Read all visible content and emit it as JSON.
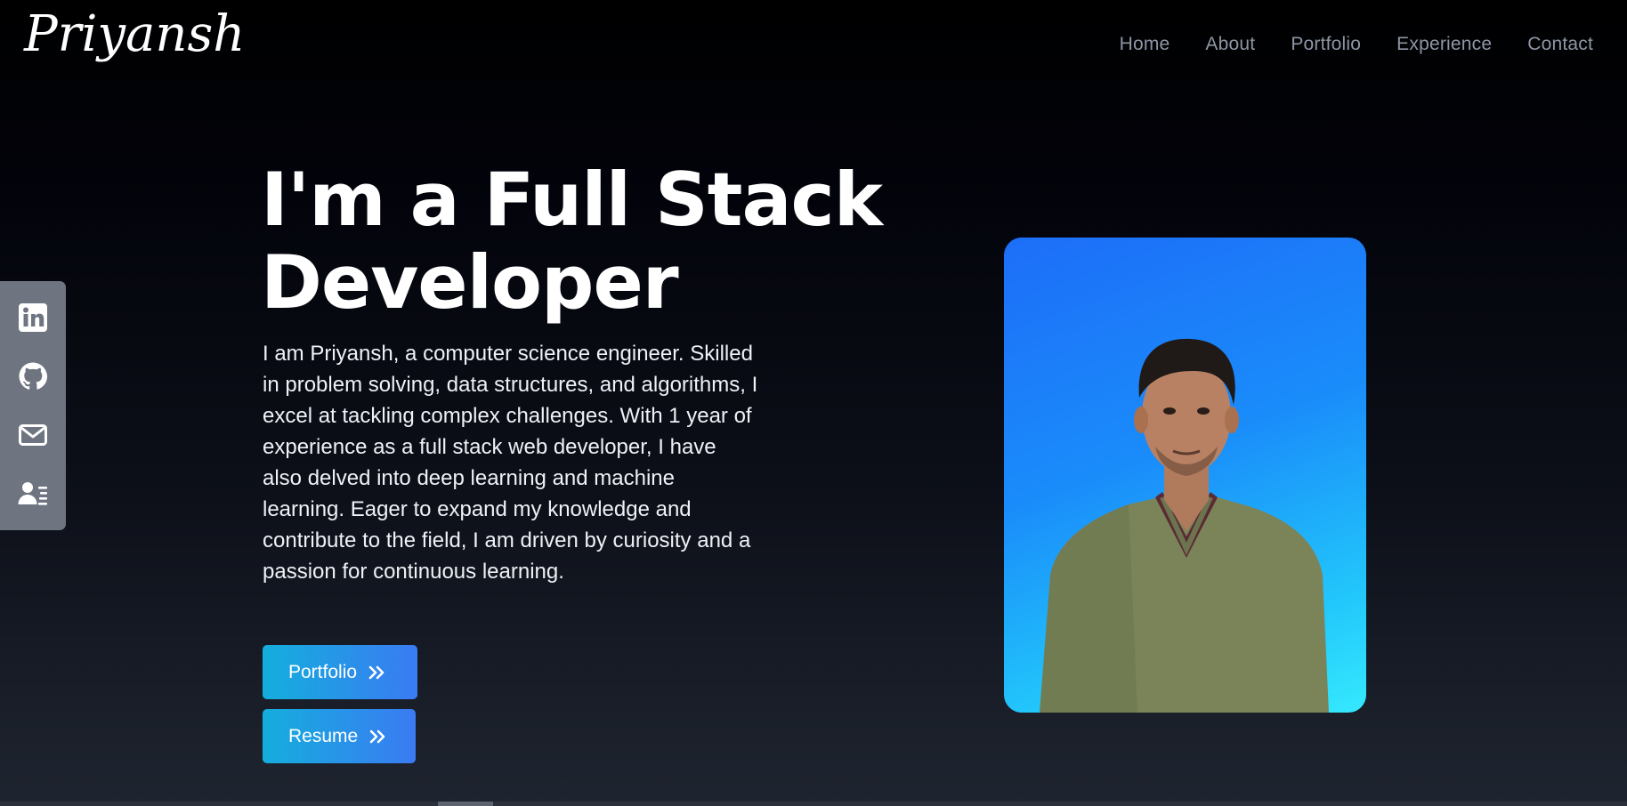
{
  "brand": {
    "logo_text": "Priyansh"
  },
  "nav": {
    "items": [
      {
        "label": "Home"
      },
      {
        "label": "About"
      },
      {
        "label": "Portfolio"
      },
      {
        "label": "Experience"
      },
      {
        "label": "Contact"
      }
    ]
  },
  "social": {
    "icons": [
      "linkedin-icon",
      "github-icon",
      "mail-icon",
      "contact-card-icon"
    ],
    "background": "#6e7480"
  },
  "hero": {
    "headline_line1": "I'm a Full Stack",
    "headline_line2": "Developer",
    "bio": "I am Priyansh, a computer science engineer. Skilled in problem solving, data structures, and algorithms, I excel at tackling complex challenges. With 1 year of experience as a full stack web developer, I have also delved into deep learning and machine learning. Eager to expand my knowledge and contribute to the field, I am driven by curiosity and a passion for continuous learning.",
    "buttons": {
      "portfolio_label": "Portfolio",
      "resume_label": "Resume"
    }
  },
  "colors": {
    "accent_gradient_start": "#14aedc",
    "accent_gradient_end": "#3a7bf3",
    "nav_text": "#8e96a4",
    "photo_bg_top": "#1d6ef8",
    "photo_bg_bottom": "#35e9fd"
  }
}
